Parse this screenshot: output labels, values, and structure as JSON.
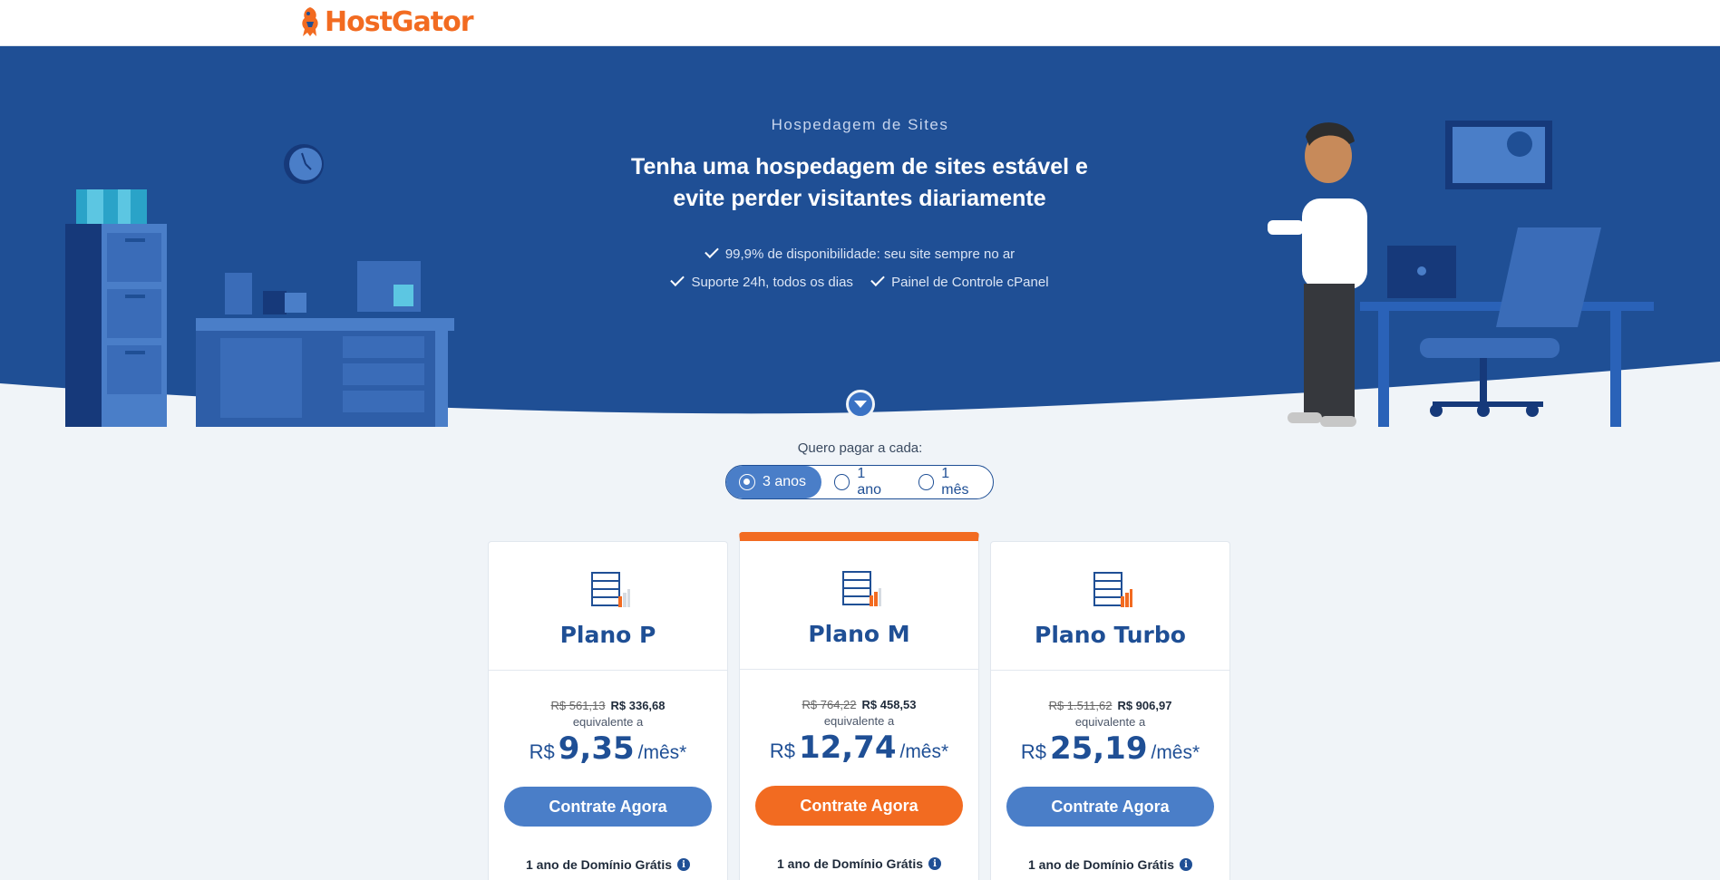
{
  "header": {
    "brand": "HostGator"
  },
  "hero": {
    "subtitle": "Hospedagem de Sites",
    "title_line1": "Tenha uma hospedagem de sites estável e",
    "title_line2": "evite perder visitantes diariamente",
    "features": [
      "99,9% de disponibilidade: seu site sempre no ar",
      "Suporte 24h, todos os dias",
      "Painel de Controle cPanel"
    ]
  },
  "billing": {
    "label": "Quero pagar a cada:",
    "options": [
      "3 anos",
      "1 ano",
      "1 mês"
    ],
    "selected": "3 anos"
  },
  "plans": [
    {
      "name": "Plano P",
      "old_price": "R$ 561,13",
      "total_price": "R$ 336,68",
      "equiv": "equivalente a",
      "currency": "R$",
      "monthly": "9,35",
      "per": "/mês*",
      "cta": "Contrate Agora",
      "domain": "1 ano de Domínio Grátis"
    },
    {
      "name": "Plano M",
      "old_price": "R$ 764,22",
      "total_price": "R$ 458,53",
      "equiv": "equivalente a",
      "currency": "R$",
      "monthly": "12,74",
      "per": "/mês*",
      "cta": "Contrate Agora",
      "domain": "1 ano de Domínio Grátis"
    },
    {
      "name": "Plano Turbo",
      "old_price": "R$ 1.511,62",
      "total_price": "R$ 906,97",
      "equiv": "equivalente a",
      "currency": "R$",
      "monthly": "25,19",
      "per": "/mês*",
      "cta": "Contrate Agora",
      "domain": "1 ano de Domínio Grátis"
    }
  ],
  "colors": {
    "primary": "#1f4f95",
    "accent": "#f26b21",
    "button": "#4a7ec8"
  }
}
